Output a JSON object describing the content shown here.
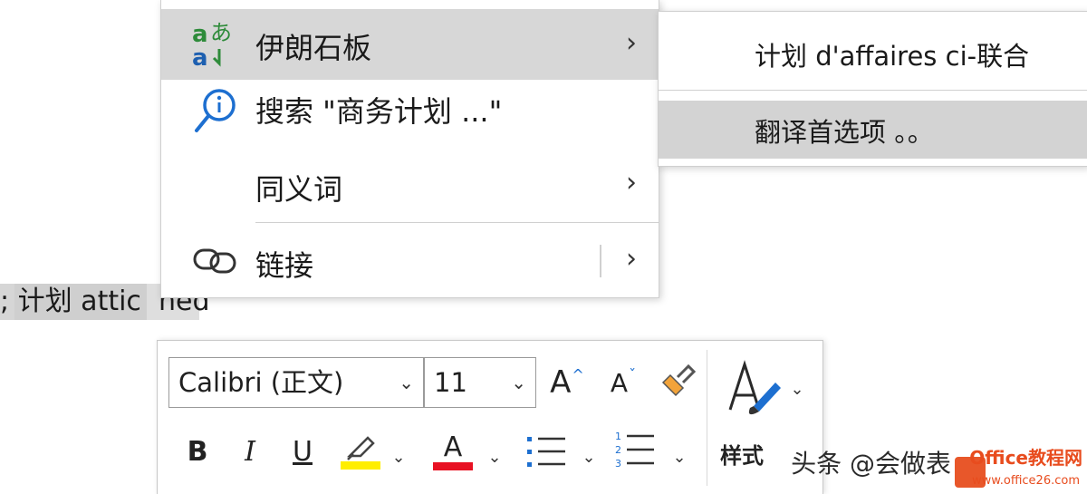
{
  "document": {
    "selected_text": "; 计划 attic  hed"
  },
  "context_menu": {
    "items": [
      {
        "label": "伊朗石板",
        "icon": "translate-icon",
        "has_submenu": true,
        "selected": true
      },
      {
        "label": "搜索 \"商务计划 ...\"",
        "icon": "search-info-icon",
        "has_submenu": false
      },
      {
        "label": "同义词",
        "icon": "",
        "has_submenu": true
      },
      {
        "label": "链接",
        "icon": "link-icon",
        "has_submenu": true
      }
    ],
    "chevron": "›"
  },
  "submenu": {
    "items": [
      {
        "label": "计划 d'affaires ci-联合"
      },
      {
        "label": "翻译首选项 。。",
        "selected": true
      }
    ]
  },
  "mini_toolbar": {
    "font_name": "Calibri (正文)",
    "font_size": "11",
    "increase_font_label": "A",
    "decrease_font_label": "A",
    "bold_label": "B",
    "italic_label": "I",
    "underline_label": "U",
    "font_color_label": "A",
    "styles_label": "样式",
    "highlight_color": "#ffee00",
    "font_color": "#e81123",
    "dropdown_caret": "⌄"
  },
  "watermark": {
    "credit": "头条 @会做表",
    "logo_text": "Office教程网",
    "logo_url_text": "www.office26.com"
  }
}
